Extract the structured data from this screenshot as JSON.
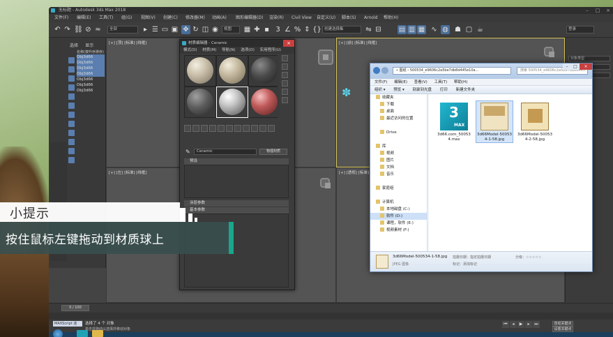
{
  "app": {
    "window_title": "无标题 - Autodesk 3ds Max 2018",
    "accent": "#5a7eb0"
  },
  "menu": [
    "文件(F)",
    "编辑(E)",
    "工具(T)",
    "组(G)",
    "视图(V)",
    "创建(C)",
    "修改器(M)",
    "动画(A)",
    "图形编辑器(D)",
    "渲染(R)",
    "Civil View",
    "自定义(U)",
    "脚本(S)",
    "Arnold",
    "帮助(H)"
  ],
  "toolbar": {
    "selection_filter": "全部",
    "view_dropdown": "视图",
    "selection_set": "创建选择集",
    "user_label": "登录"
  },
  "scene_explorer": {
    "tabs": [
      "选择",
      "显示"
    ],
    "header": "名称(按升序排序)",
    "objects": [
      "Obj3d66",
      "Obj3d66",
      "Obj3d66",
      "Obj3d66",
      "Obj3d66",
      "Obj3d66",
      "Obj3d66"
    ]
  },
  "viewports": {
    "top": "[+] [顶] [标准] [线框]",
    "front": "[+] [前] [标准] [线框]",
    "left": "[+] [左] [标准] [线框]",
    "perspective": "[+] [透视] [标准] [默认明暗处理]"
  },
  "material_editor": {
    "title": "材质编辑器 - Ceramic",
    "menu": [
      "模式(D)",
      "材质(M)",
      "导航(N)",
      "选项(O)",
      "实用程序(U)"
    ],
    "material_name": "Ceramic",
    "material_type": "物理材质",
    "rollouts": [
      "预设",
      "涂层参数",
      "基本参数"
    ]
  },
  "explorer": {
    "address": "« 图纸 › 500534_e9606c2a5be7db8d445e10a...",
    "search": "搜索 500534_e9606c2a5be7db8d445...",
    "menu": [
      "文件(F)",
      "编辑(E)",
      "查看(V)",
      "工具(T)",
      "帮助(H)"
    ],
    "commands": [
      "组织 ▾",
      "预览 ▾",
      "刻录到光盘",
      "打印",
      "新建文件夹"
    ],
    "nav_items": [
      {
        "label": "收藏夹",
        "sub": false
      },
      {
        "label": "下载",
        "sub": true
      },
      {
        "label": "桌面",
        "sub": true
      },
      {
        "label": "最近访问的位置",
        "sub": true
      },
      {
        "label": "",
        "sub": false
      },
      {
        "label": "Drive",
        "sub": true
      },
      {
        "label": "",
        "sub": false
      },
      {
        "label": "库",
        "sub": false
      },
      {
        "label": "视频",
        "sub": true
      },
      {
        "label": "图片",
        "sub": true
      },
      {
        "label": "文档",
        "sub": true
      },
      {
        "label": "音乐",
        "sub": true
      },
      {
        "label": "",
        "sub": false
      },
      {
        "label": "家庭组",
        "sub": false
      },
      {
        "label": "",
        "sub": false
      },
      {
        "label": "计算机",
        "sub": false
      },
      {
        "label": "本地磁盘 (C:)",
        "sub": true
      },
      {
        "label": "软件 (D:)",
        "sub": true
      },
      {
        "label": "课程，软件 (E:)",
        "sub": true
      },
      {
        "label": "视频素材 (F:)",
        "sub": true
      }
    ],
    "files": [
      {
        "name": "3d66.com_500534.max",
        "kind": "max",
        "badge": "3",
        "badge_sub": "MAX"
      },
      {
        "name": "3d66Model-500534-1-58.jpg",
        "kind": "jpg1"
      },
      {
        "name": "3d66Model-500534-2-58.jpg",
        "kind": "jpg2"
      }
    ],
    "status": {
      "name": "3d66Model-500534-1-58.jpg",
      "type": "JPEG 图像",
      "taken_label": "拍摄日期：",
      "taken_value": "指定拍摄日期",
      "tags_label": "标记：",
      "tags_value": "添加标记",
      "rating_label": "分级：",
      "rating_value": "☆☆☆☆☆"
    }
  },
  "command_panel": {
    "rows": [
      "对象类型",
      "标准基本体",
      "名称和颜色"
    ]
  },
  "timeline": {
    "frame": "0 / 100"
  },
  "status": {
    "line1": "选择了 4 个 对象",
    "line2": "单击并拖动以选择并移动对象",
    "maxscript": "MAXScript 迷",
    "auto_key": "自动关键点",
    "set_key": "设置关键点"
  },
  "tip": {
    "heading": "小提示",
    "body": "按住鼠标左键拖动到材质球上"
  }
}
